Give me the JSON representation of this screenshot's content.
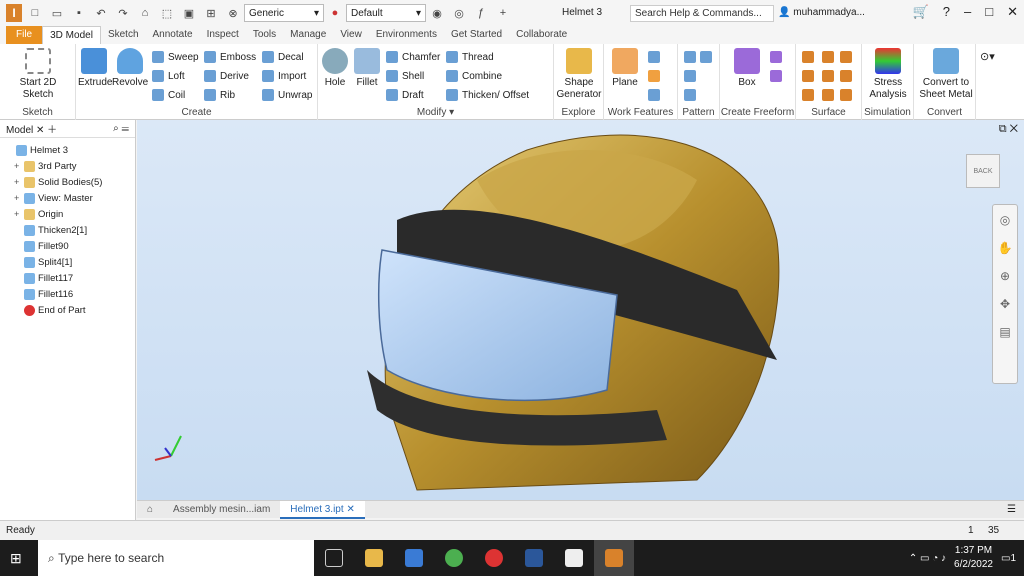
{
  "qat": {
    "style_value": "Generic",
    "appearance_value": "Default",
    "doc_title": "Helmet 3",
    "search_placeholder": "Search Help & Commands...",
    "user": "muhammadya..."
  },
  "tabs": [
    "File",
    "3D Model",
    "Sketch",
    "Annotate",
    "Inspect",
    "Tools",
    "Manage",
    "View",
    "Environments",
    "Get Started",
    "Collaborate"
  ],
  "ribbon": {
    "sketch": {
      "label": "Sketch",
      "start": "Start 2D Sketch"
    },
    "create": {
      "label": "Create",
      "extrude": "Extrude",
      "revolve": "Revolve",
      "sweep": "Sweep",
      "loft": "Loft",
      "coil": "Coil",
      "emboss": "Emboss",
      "derive": "Derive",
      "rib": "Rib",
      "decal": "Decal",
      "import": "Import",
      "unwrap": "Unwrap"
    },
    "modify": {
      "label": "Modify",
      "hole": "Hole",
      "fillet": "Fillet",
      "chamfer": "Chamfer",
      "shell": "Shell",
      "draft": "Draft",
      "thread": "Thread",
      "combine": "Combine",
      "thicken": "Thicken/ Offset"
    },
    "explore": {
      "label": "Explore",
      "shape": "Shape Generator"
    },
    "work": {
      "label": "Work Features",
      "plane": "Plane"
    },
    "pattern": {
      "label": "Pattern"
    },
    "freeform": {
      "label": "Create Freeform",
      "box": "Box"
    },
    "surface": {
      "label": "Surface"
    },
    "simulation": {
      "label": "Simulation",
      "stress": "Stress Analysis"
    },
    "convert": {
      "label": "Convert",
      "sheet": "Convert to Sheet Metal"
    }
  },
  "browser": {
    "tab": "Model",
    "nodes": [
      {
        "label": "Helmet 3",
        "indent": 0,
        "exp": "",
        "kind": "part"
      },
      {
        "label": "3rd Party",
        "indent": 1,
        "exp": "+",
        "kind": "folder"
      },
      {
        "label": "Solid Bodies(5)",
        "indent": 1,
        "exp": "+",
        "kind": "folder"
      },
      {
        "label": "View: Master",
        "indent": 1,
        "exp": "+",
        "kind": "view"
      },
      {
        "label": "Origin",
        "indent": 1,
        "exp": "+",
        "kind": "folder"
      },
      {
        "label": "Thicken2[1]",
        "indent": 1,
        "exp": "",
        "kind": "feat"
      },
      {
        "label": "Fillet90",
        "indent": 1,
        "exp": "",
        "kind": "feat"
      },
      {
        "label": "Split4[1]",
        "indent": 1,
        "exp": "",
        "kind": "feat"
      },
      {
        "label": "Fillet117",
        "indent": 1,
        "exp": "",
        "kind": "feat"
      },
      {
        "label": "Fillet116",
        "indent": 1,
        "exp": "",
        "kind": "feat"
      },
      {
        "label": "End of Part",
        "indent": 1,
        "exp": "",
        "kind": "end"
      }
    ]
  },
  "doctabs": [
    "Assembly mesin...iam",
    "Helmet 3.ipt"
  ],
  "status": {
    "text": "Ready",
    "page": "1",
    "count": "35"
  },
  "taskbar": {
    "search": "Type here to search",
    "time": "1:37 PM",
    "date": "6/2/2022",
    "notif": "1"
  },
  "viewcube": {
    "face": "BACK"
  }
}
